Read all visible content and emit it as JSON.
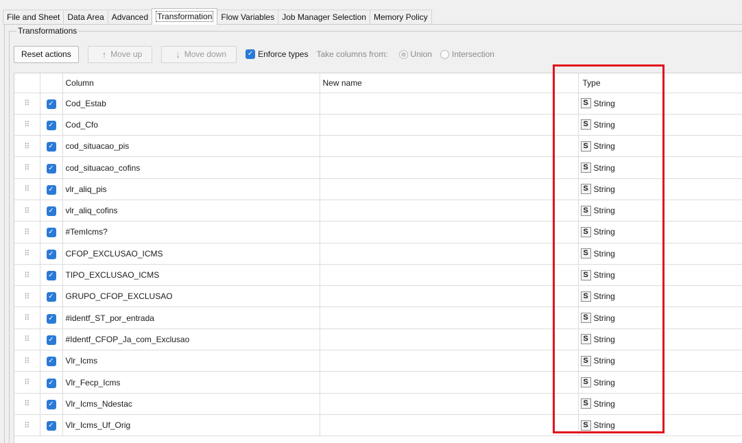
{
  "tabs": [
    {
      "label": "File and Sheet"
    },
    {
      "label": "Data Area"
    },
    {
      "label": "Advanced"
    },
    {
      "label": "Transformation"
    },
    {
      "label": "Flow Variables"
    },
    {
      "label": "Job Manager Selection"
    },
    {
      "label": "Memory Policy"
    }
  ],
  "group": {
    "title": "Transformations"
  },
  "toolbar": {
    "reset_label": "Reset actions",
    "move_up_label": "Move up",
    "move_down_label": "Move down",
    "enforce_label": "Enforce types",
    "take_from_label": "Take columns from:",
    "union_label": "Union",
    "intersection_label": "Intersection"
  },
  "table": {
    "headers": {
      "column": "Column",
      "new_name": "New name",
      "type": "Type"
    },
    "rows": [
      {
        "column": "Cod_Estab",
        "type_badge": "S",
        "type": "String"
      },
      {
        "column": "Cod_Cfo",
        "type_badge": "S",
        "type": "String"
      },
      {
        "column": "cod_situacao_pis",
        "type_badge": "S",
        "type": "String"
      },
      {
        "column": "cod_situacao_cofins",
        "type_badge": "S",
        "type": "String"
      },
      {
        "column": "vlr_aliq_pis",
        "type_badge": "S",
        "type": "String"
      },
      {
        "column": "vlr_aliq_cofins",
        "type_badge": "S",
        "type": "String"
      },
      {
        "column": "#TemIcms?",
        "type_badge": "S",
        "type": "String"
      },
      {
        "column": "CFOP_EXCLUSAO_ICMS",
        "type_badge": "S",
        "type": "String"
      },
      {
        "column": "TIPO_EXCLUSAO_ICMS",
        "type_badge": "S",
        "type": "String"
      },
      {
        "column": "GRUPO_CFOP_EXCLUSAO",
        "type_badge": "S",
        "type": "String"
      },
      {
        "column": "#identf_ST_por_entrada",
        "type_badge": "S",
        "type": "String"
      },
      {
        "column": "#Identf_CFOP_Ja_com_Exclusao",
        "type_badge": "S",
        "type": "String"
      },
      {
        "column": "Vlr_Icms",
        "type_badge": "S",
        "type": "String"
      },
      {
        "column": "Vlr_Fecp_Icms",
        "type_badge": "S",
        "type": "String"
      },
      {
        "column": "Vlr_Icms_Ndestac",
        "type_badge": "S",
        "type": "String"
      },
      {
        "column": "Vlr_Icms_Uf_Orig",
        "type_badge": "S",
        "type": "String"
      }
    ]
  },
  "colors": {
    "accent": "#2a7ad6",
    "highlight": "#e3111b"
  }
}
